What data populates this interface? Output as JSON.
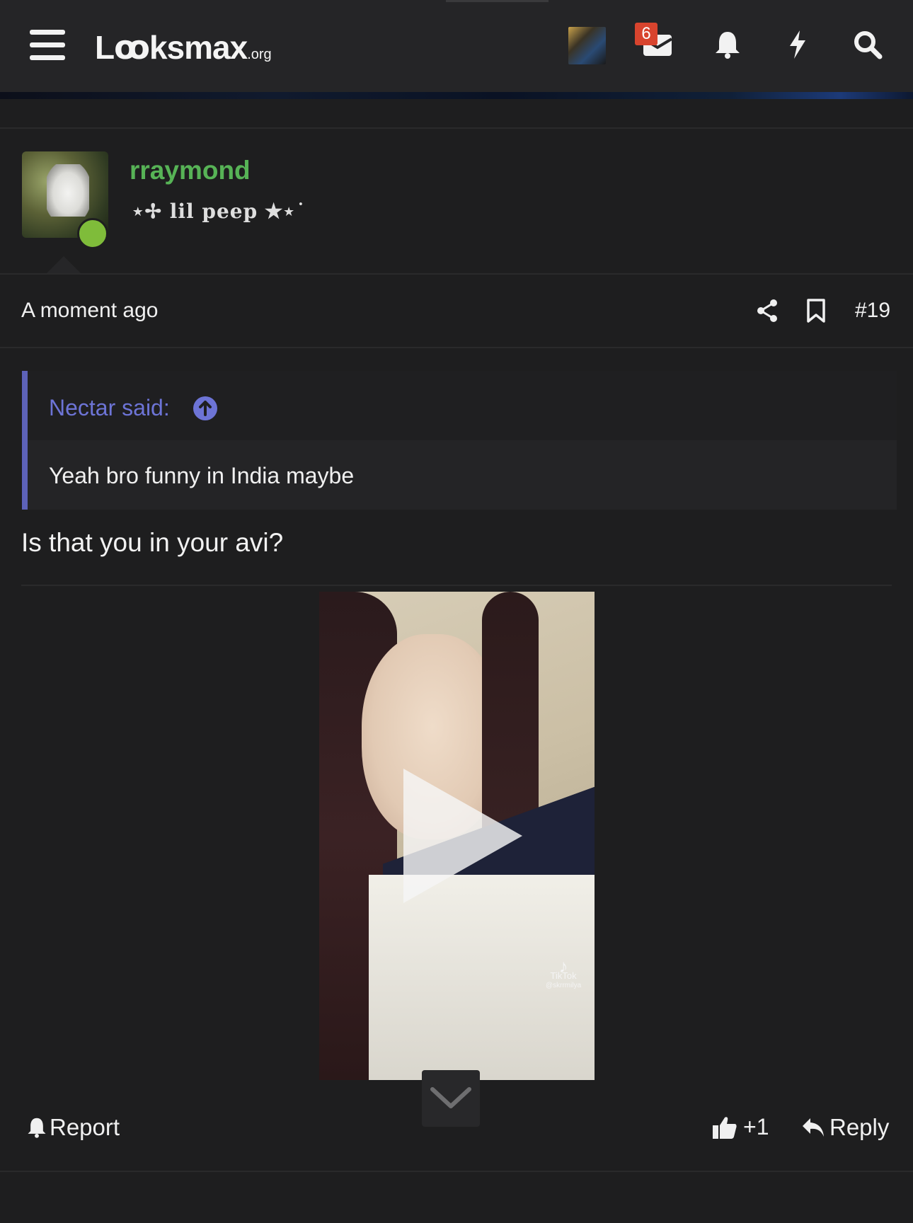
{
  "header": {
    "logo_main": "Lꝏksmax",
    "logo_suffix": ".org",
    "inbox_badge": "6",
    "icons": [
      "menu-icon",
      "avatar",
      "inbox-icon",
      "bell-icon",
      "bolt-icon",
      "search-icon"
    ]
  },
  "post": {
    "username": "rraymond",
    "user_title": "⋆✢ lil peep ✭⋆˙",
    "timestamp": "A moment ago",
    "post_number": "#19",
    "quote": {
      "author": "Nectar said:",
      "text": "Yeah bro funny in India maybe"
    },
    "body": "Is that you in your avi?",
    "video": {
      "watermark": "TikTok",
      "watermark_handle": "@skrrmilya"
    },
    "actions": {
      "report": "Report",
      "like_count": "+1",
      "reply": "Reply"
    }
  },
  "colors": {
    "background": "#1e1e1f",
    "header": "#252527",
    "username": "#57b356",
    "quote_accent": "#6d74d6",
    "badge": "#d8442e",
    "online": "#7fbc3a"
  }
}
